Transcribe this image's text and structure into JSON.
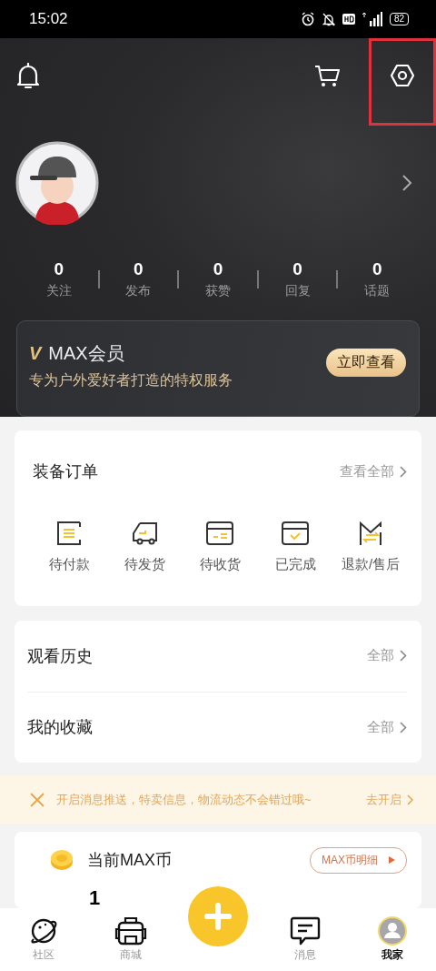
{
  "status_bar": {
    "time": "15:02",
    "battery": "82"
  },
  "profile": {
    "stats": [
      {
        "value": "0",
        "label": "关注"
      },
      {
        "value": "0",
        "label": "发布"
      },
      {
        "value": "0",
        "label": "获赞"
      },
      {
        "value": "0",
        "label": "回复"
      },
      {
        "value": "0",
        "label": "话题"
      }
    ]
  },
  "vip": {
    "badge": "V",
    "title": "MAX会员",
    "subtitle": "专为户外爱好者打造的特权服务",
    "button": "立即查看"
  },
  "orders": {
    "title": "装备订单",
    "more": "查看全部",
    "items": [
      {
        "kind": "pay",
        "label": "待付款"
      },
      {
        "kind": "ship",
        "label": "待发货"
      },
      {
        "kind": "receive",
        "label": "待收货"
      },
      {
        "kind": "done",
        "label": "已完成"
      },
      {
        "kind": "refund",
        "label": "退款/售后"
      }
    ]
  },
  "links": [
    {
      "label": "观看历史",
      "more": "全部"
    },
    {
      "label": "我的收藏",
      "more": "全部"
    }
  ],
  "notice": {
    "text": "开启消息推送，特卖信息，物流动态不会错过哦~",
    "action": "去开启"
  },
  "coins": {
    "title": "当前MAX币",
    "button": "MAX币明细",
    "value": "1"
  },
  "nav": [
    {
      "kind": "community",
      "label": "社区",
      "selected": false
    },
    {
      "kind": "shop",
      "label": "商城",
      "selected": false
    },
    {
      "kind": "post"
    },
    {
      "kind": "messages",
      "label": "消息",
      "selected": false
    },
    {
      "kind": "me",
      "label": "我家",
      "selected": true
    }
  ]
}
